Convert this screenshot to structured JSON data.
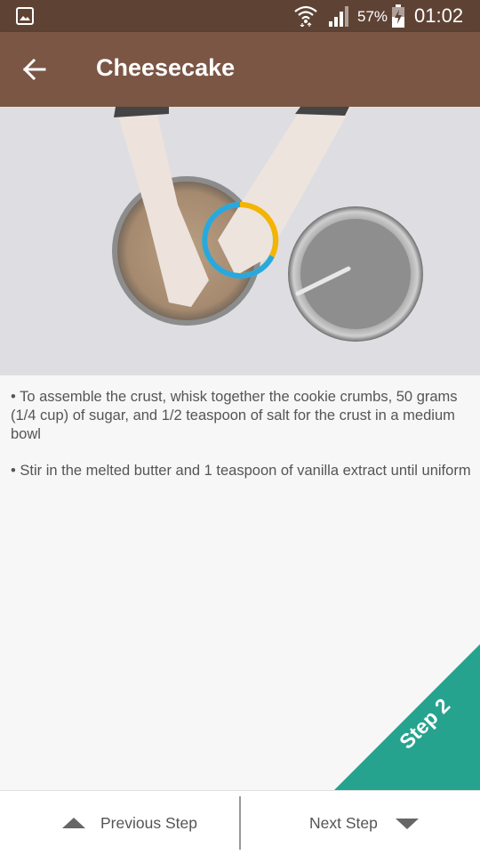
{
  "status_bar": {
    "battery_percent": "57%",
    "time": "01:02",
    "icons": [
      "gallery-icon",
      "wifi-icon",
      "signal-icon",
      "battery-charging-icon"
    ]
  },
  "app_bar": {
    "title": "Cheesecake",
    "back_icon": "arrow-back-icon"
  },
  "video": {
    "loading_indicator": "circular-progress",
    "colors": [
      "#29a8e0",
      "#f5b400",
      "#8bc34a"
    ]
  },
  "instructions": [
    "• To assemble the crust, whisk together the cookie crumbs, 50 grams (1/4 cup) of sugar, and 1/2 teaspoon of salt for the crust in a medium bowl",
    "• Stir in the melted butter and 1 teaspoon of vanilla extract until uniform"
  ],
  "step_badge": {
    "label": "Step 2",
    "color": "#26a38f"
  },
  "bottom_nav": {
    "previous_label": "Previous Step",
    "next_label": "Next Step"
  },
  "theme": {
    "status_bar_color": "#5e4335",
    "app_bar_color": "#7b5645"
  }
}
